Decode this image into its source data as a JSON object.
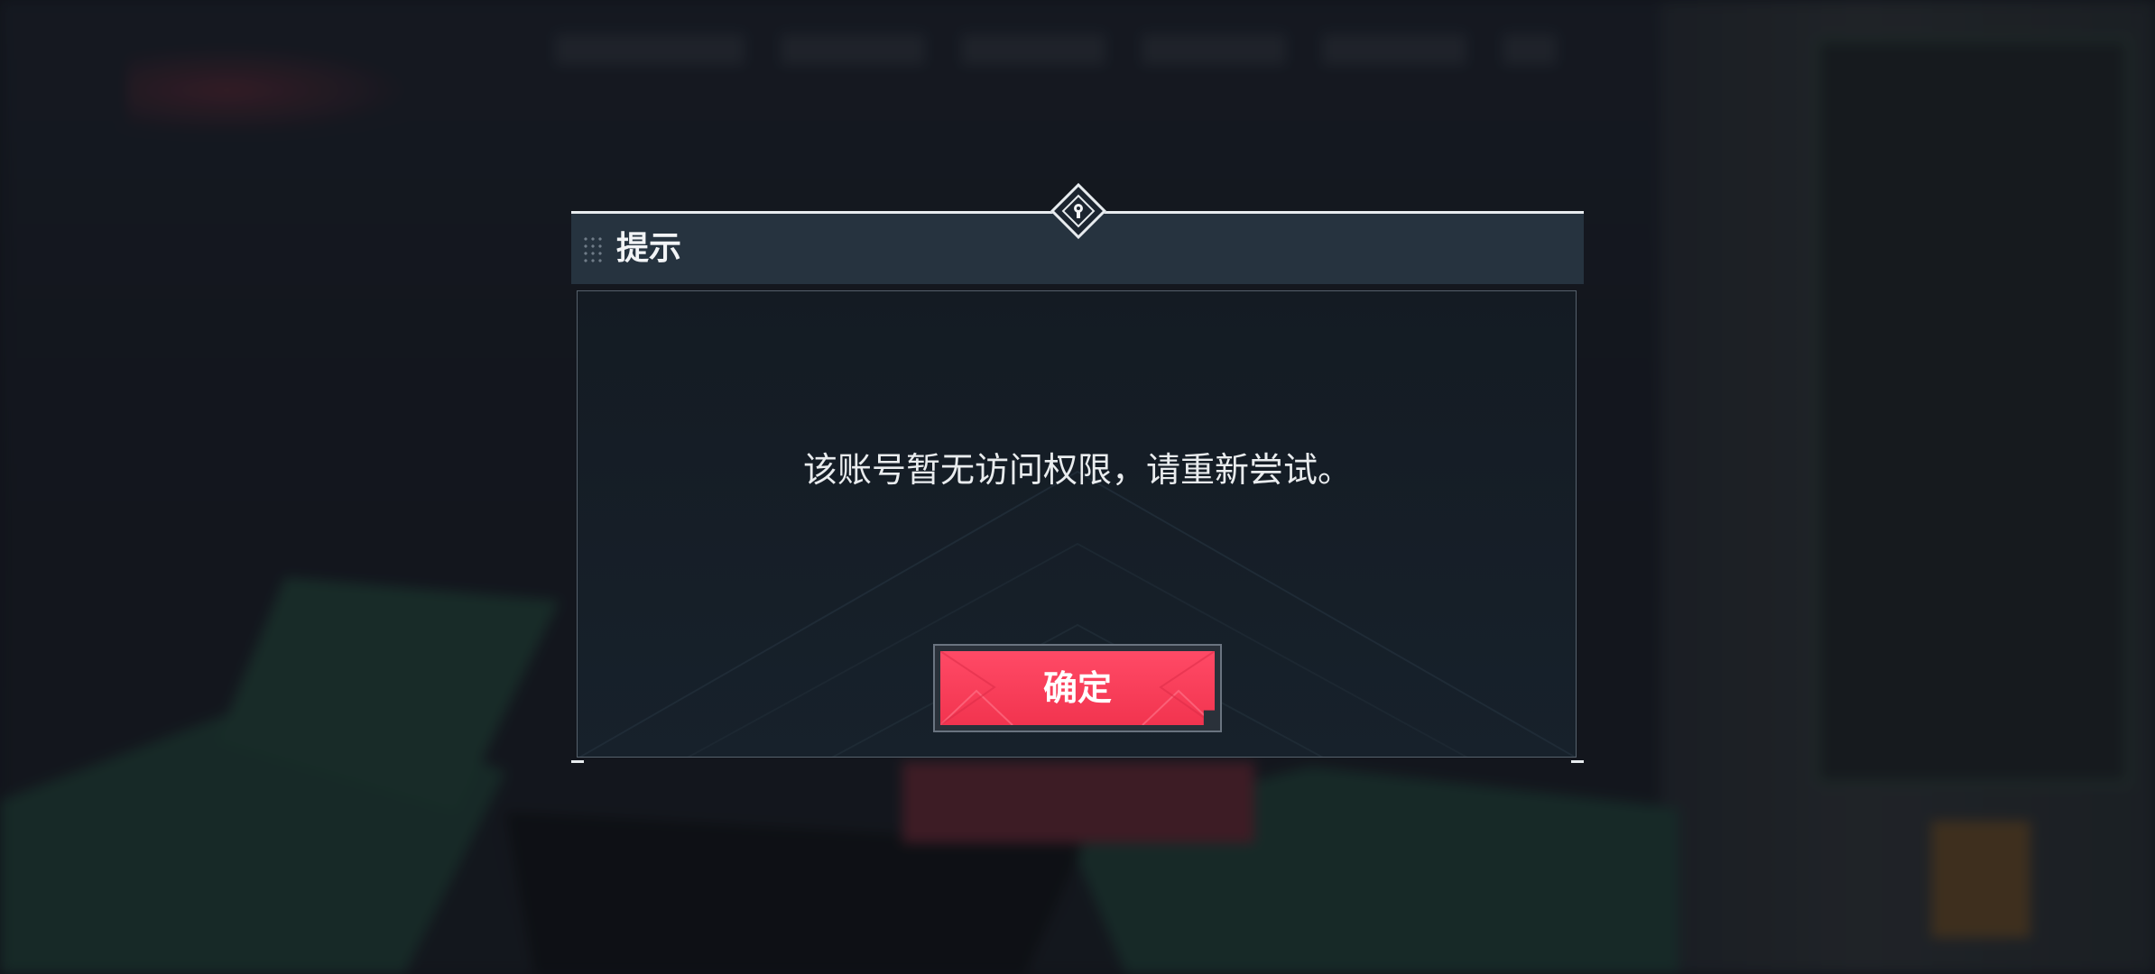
{
  "dialog": {
    "title": "提示",
    "message": "该账号暂无访问权限，请重新尝试。",
    "confirm_label": "确定",
    "emblem_icon": "keyhole-diamond-icon"
  },
  "colors": {
    "confirm_button": "#f2344f",
    "header": "#26333f",
    "body": "#17212b"
  }
}
